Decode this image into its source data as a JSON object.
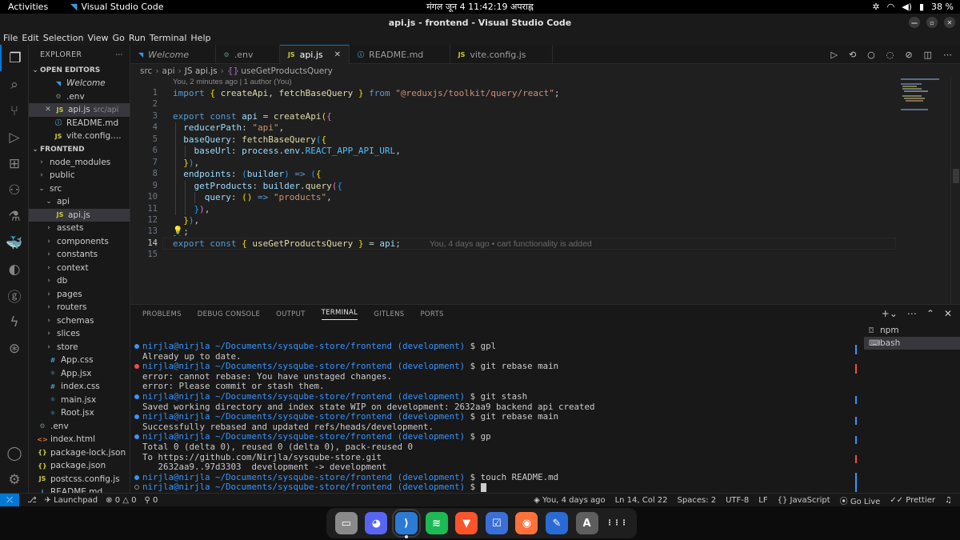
{
  "system": {
    "activities": "Activities",
    "app_name": "Visual Studio Code",
    "clock": "मंगल जून 4  11:42:19 अपराह्न",
    "battery": "38 %"
  },
  "window": {
    "title": "api.js - frontend - Visual Studio Code"
  },
  "menu": [
    "File",
    "Edit",
    "Selection",
    "View",
    "Go",
    "Run",
    "Terminal",
    "Help"
  ],
  "explorer": {
    "header": "EXPLORER",
    "open_editors_label": "OPEN EDITORS",
    "open_editors": [
      {
        "icon": "vscode-icon",
        "name": "Welcome",
        "desc": ""
      },
      {
        "icon": "gear-icon",
        "name": ".env",
        "desc": ""
      },
      {
        "icon": "js-icon",
        "name": "api.js",
        "desc": "src/api",
        "close": "✕"
      },
      {
        "icon": "info-icon",
        "name": "README.md",
        "desc": ""
      },
      {
        "icon": "js-icon",
        "name": "vite.config....",
        "desc": ""
      }
    ],
    "folder_label": "FRONTEND",
    "tree": [
      {
        "type": "folder",
        "name": "node_modules",
        "depth": 0,
        "open": false
      },
      {
        "type": "folder",
        "name": "public",
        "depth": 0,
        "open": false
      },
      {
        "type": "folder",
        "name": "src",
        "depth": 0,
        "open": true
      },
      {
        "type": "folder",
        "name": "api",
        "depth": 1,
        "open": true
      },
      {
        "type": "file",
        "ext": "JS",
        "name": "api.js",
        "depth": 2,
        "selected": true
      },
      {
        "type": "folder",
        "name": "assets",
        "depth": 1,
        "open": false
      },
      {
        "type": "folder",
        "name": "components",
        "depth": 1,
        "open": false
      },
      {
        "type": "folder",
        "name": "constants",
        "depth": 1,
        "open": false
      },
      {
        "type": "folder",
        "name": "context",
        "depth": 1,
        "open": false
      },
      {
        "type": "folder",
        "name": "db",
        "depth": 1,
        "open": false
      },
      {
        "type": "folder",
        "name": "pages",
        "depth": 1,
        "open": false
      },
      {
        "type": "folder",
        "name": "routers",
        "depth": 1,
        "open": false
      },
      {
        "type": "folder",
        "name": "schemas",
        "depth": 1,
        "open": false
      },
      {
        "type": "folder",
        "name": "slices",
        "depth": 1,
        "open": false
      },
      {
        "type": "folder",
        "name": "store",
        "depth": 1,
        "open": false
      },
      {
        "type": "file",
        "ext": "#",
        "name": "App.css",
        "depth": 1
      },
      {
        "type": "file",
        "ext": "⚛",
        "name": "App.jsx",
        "depth": 1
      },
      {
        "type": "file",
        "ext": "#",
        "name": "index.css",
        "depth": 1
      },
      {
        "type": "file",
        "ext": "⚛",
        "name": "main.jsx",
        "depth": 1
      },
      {
        "type": "file",
        "ext": "⚛",
        "name": "Root.jsx",
        "depth": 1
      },
      {
        "type": "file",
        "ext": "⚙",
        "name": ".env",
        "depth": 0
      },
      {
        "type": "file",
        "ext": "<>",
        "name": "index.html",
        "depth": 0
      },
      {
        "type": "file",
        "ext": "{}",
        "name": "package-lock.json",
        "depth": 0
      },
      {
        "type": "file",
        "ext": "{}",
        "name": "package.json",
        "depth": 0
      },
      {
        "type": "file",
        "ext": "JS",
        "name": "postcss.config.js",
        "depth": 0
      },
      {
        "type": "file",
        "ext": "i",
        "name": "README.md",
        "depth": 0
      }
    ]
  },
  "tabs": [
    {
      "icon": "vscode-icon",
      "label": "Welcome",
      "active": false
    },
    {
      "icon": "gear-icon",
      "label": ".env",
      "active": false
    },
    {
      "icon": "js-icon",
      "label": "api.js",
      "active": true
    },
    {
      "icon": "info-icon",
      "label": "README.md",
      "active": false
    },
    {
      "icon": "js-icon",
      "label": "vite.config.js",
      "active": false
    }
  ],
  "breadcrumbs": [
    "src",
    "api",
    "JS api.js",
    "useGetProductsQuery"
  ],
  "blame_header": "You, 2 minutes ago | 1 author (You)",
  "inline_blame": "You, 4 days ago • cart functionality is added",
  "line_numbers": [
    "1",
    "2",
    "3",
    "4",
    "5",
    "6",
    "7",
    "8",
    "9",
    "10",
    "11",
    "12",
    "13",
    "14",
    "15"
  ],
  "code_lines": [
    "import { createApi, fetchBaseQuery } from \"@reduxjs/toolkit/query/react\";",
    "",
    "export const api = createApi({",
    "  reducerPath: \"api\",",
    "  baseQuery: fetchBaseQuery({",
    "    baseUrl: process.env.REACT_APP_API_URL,",
    "  }),",
    "  endpoints: (builder) => ({",
    "    getProducts: builder.query({",
    "      query: () => \"products\",",
    "    }),",
    "  }),",
    "});",
    "export const { useGetProductsQuery } = api;",
    ""
  ],
  "panel": {
    "tabs": [
      "PROBLEMS",
      "DEBUG CONSOLE",
      "OUTPUT",
      "TERMINAL",
      "GITLENS",
      "PORTS"
    ],
    "active_tab": "TERMINAL",
    "terminals": [
      "npm",
      "bash"
    ],
    "prompt_user": "nirjla@nirjla",
    "prompt_path": "~/Documents/sysqube-store/frontend",
    "prompt_branch": "(development)",
    "lines": [
      {
        "kind": "prompt",
        "status": "ok",
        "cmd": "gpl"
      },
      {
        "kind": "out",
        "text": "Already up to date."
      },
      {
        "kind": "prompt",
        "status": "err",
        "cmd": "git rebase main"
      },
      {
        "kind": "out",
        "text": "error: cannot rebase: You have unstaged changes."
      },
      {
        "kind": "out",
        "text": "error: Please commit or stash them."
      },
      {
        "kind": "prompt",
        "status": "ok",
        "cmd": "git stash"
      },
      {
        "kind": "out",
        "text": "Saved working directory and index state WIP on development: 2632aa9 backend api created"
      },
      {
        "kind": "prompt",
        "status": "ok",
        "cmd": "git rebase main"
      },
      {
        "kind": "out",
        "text": "Successfully rebased and updated refs/heads/development."
      },
      {
        "kind": "prompt",
        "status": "ok",
        "cmd": "gp"
      },
      {
        "kind": "out",
        "text": "Total 0 (delta 0), reused 0 (delta 0), pack-reused 0"
      },
      {
        "kind": "out",
        "text": "To https://github.com/Nirjla/sysqube-store.git"
      },
      {
        "kind": "out",
        "text": "   2632aa9..97d3303  development -> development"
      },
      {
        "kind": "prompt",
        "status": "ok",
        "cmd": "touch README.md"
      },
      {
        "kind": "prompt",
        "status": "idle",
        "cmd": "",
        "cursor": true
      }
    ]
  },
  "statusbar": {
    "branch_icon": "⑂",
    "launchpad": "Launchpad",
    "errors": "0",
    "warnings": "0",
    "ports": "0",
    "blame": "You, 4 days ago",
    "position": "Ln 14, Col 22",
    "spaces": "Spaces: 2",
    "encoding": "UTF-8",
    "eol": "LF",
    "language": "JavaScript",
    "golive": "Go Live",
    "prettier": "Prettier"
  },
  "dock": [
    {
      "name": "files-app",
      "glyph": "▭",
      "color": "#8a8a8a"
    },
    {
      "name": "discord-app",
      "glyph": "◕",
      "color": "#5865f2"
    },
    {
      "name": "vscode-app",
      "glyph": "⟩",
      "color": "#2b7bd6"
    },
    {
      "name": "spotify-app",
      "glyph": "≋",
      "color": "#1db954"
    },
    {
      "name": "brave-app",
      "glyph": "▼",
      "color": "#fb542b"
    },
    {
      "name": "tasks-app",
      "glyph": "☑",
      "color": "#3b6fd8"
    },
    {
      "name": "firefox-app",
      "glyph": "◉",
      "color": "#ff7139"
    },
    {
      "name": "text-editor-app",
      "glyph": "✎",
      "color": "#2a6ad4"
    },
    {
      "name": "software-app",
      "glyph": "A",
      "color": "#5e5e5e"
    },
    {
      "name": "show-apps",
      "glyph": "⋮⋮⋮",
      "color": "#1e1e1e"
    }
  ]
}
